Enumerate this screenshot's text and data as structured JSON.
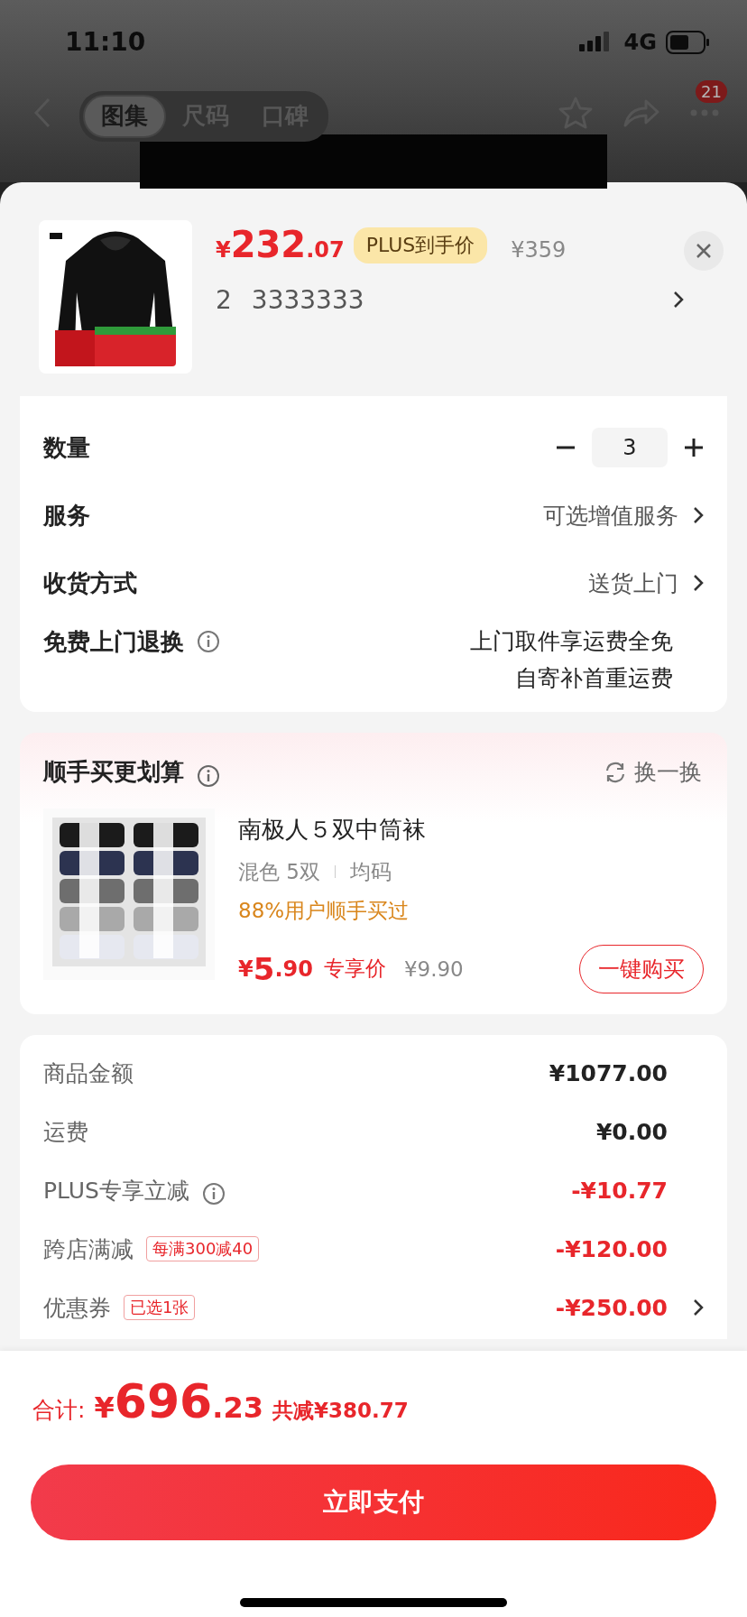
{
  "status_bar": {
    "time": "11:10",
    "network": "4G"
  },
  "nav": {
    "tabs": [
      {
        "label": "图集",
        "selected": true
      },
      {
        "label": "尺码",
        "selected": false
      },
      {
        "label": "口碑",
        "selected": false
      }
    ],
    "badge": "21"
  },
  "product": {
    "symbol": "¥",
    "price_int": "232",
    "price_dec": ".07",
    "plus_tag": "PLUS到手价",
    "original_price": "¥359",
    "spec": [
      "2",
      "3333333"
    ]
  },
  "options": [
    {
      "kind": "stepper",
      "label": "数量",
      "value": "3"
    },
    {
      "kind": "link",
      "label": "服务",
      "value": "可选增值服务"
    },
    {
      "kind": "link",
      "label": "收货方式",
      "value": "送货上门"
    },
    {
      "kind": "info",
      "label": "免费上门退换",
      "lines": [
        "上门取件享运费全免",
        "自寄补首重运费"
      ]
    }
  ],
  "addon": {
    "title": "顺手买更划算",
    "refresh": "换一换",
    "name": "南极人５双中筒袜",
    "spec": [
      "混色 5双",
      "均码"
    ],
    "note": "88%用户顺手买过",
    "symbol": "¥",
    "price_int": "5",
    "price_dec": ".90",
    "price_tag": "专享价",
    "original_price": "¥9.90",
    "buy": "一键购买"
  },
  "summary": [
    {
      "kind": "amount",
      "label": "商品金额",
      "value": "¥1077.00",
      "info": false,
      "chevron": false
    },
    {
      "kind": "amount",
      "label": "运费",
      "value": "¥0.00",
      "info": false,
      "chevron": false
    },
    {
      "kind": "discount",
      "label": "PLUS专享立减",
      "value": "-¥10.77",
      "info": true,
      "chevron": false
    },
    {
      "kind": "discount",
      "label": "跨店满减",
      "tag": "每满300减40",
      "value": "-¥120.00",
      "info": false,
      "chevron": false
    },
    {
      "kind": "discount",
      "label": "优惠券",
      "tag": "已选1张",
      "value": "-¥250.00",
      "info": false,
      "chevron": true
    }
  ],
  "total": {
    "label": "合计:",
    "symbol": "¥",
    "int": "696",
    "dec": ".23",
    "saved": "共减¥380.77"
  },
  "pay_button": "立即支付"
}
